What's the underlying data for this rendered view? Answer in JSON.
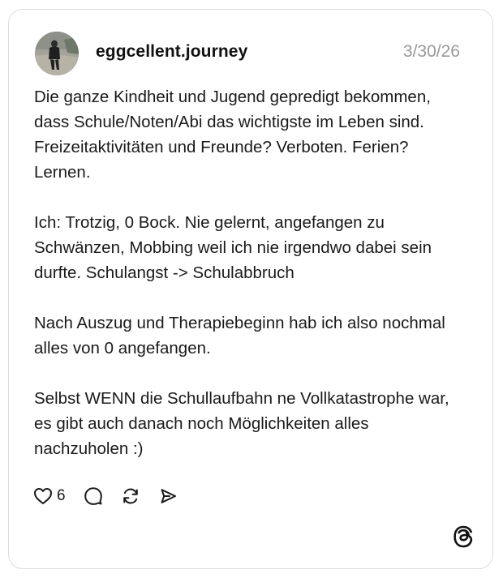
{
  "post": {
    "username": "eggcellent.journey",
    "date": "3/30/26",
    "paragraphs": [
      "Die ganze Kindheit und Jugend gepredigt bekommen, dass Schule/Noten/Abi das wichtigste im Leben sind. Freizeitaktivitäten und Freunde? Verboten. Ferien? Lernen.",
      "Ich: Trotzig, 0 Bock. Nie gelernt, angefangen zu Schwänzen, Mobbing weil ich nie irgendwo dabei sein durfte. Schulangst -> Schulabbruch",
      "Nach Auszug und Therapiebeginn hab ich also nochmal alles von 0 angefangen.",
      "Selbst WENN die Schullaufbahn ne Vollkatastrophe war, es gibt auch danach noch Möglichkeiten alles nachzuholen :)"
    ],
    "like_count": "6"
  },
  "icons": {
    "like": "heart-icon",
    "reply": "comment-bubble-icon",
    "repost": "repost-icon",
    "share": "send-icon",
    "brand": "threads-logo-icon"
  },
  "colors": {
    "text": "#1a1a1a",
    "muted": "#9a9a9a",
    "border": "#dcdcdc"
  }
}
